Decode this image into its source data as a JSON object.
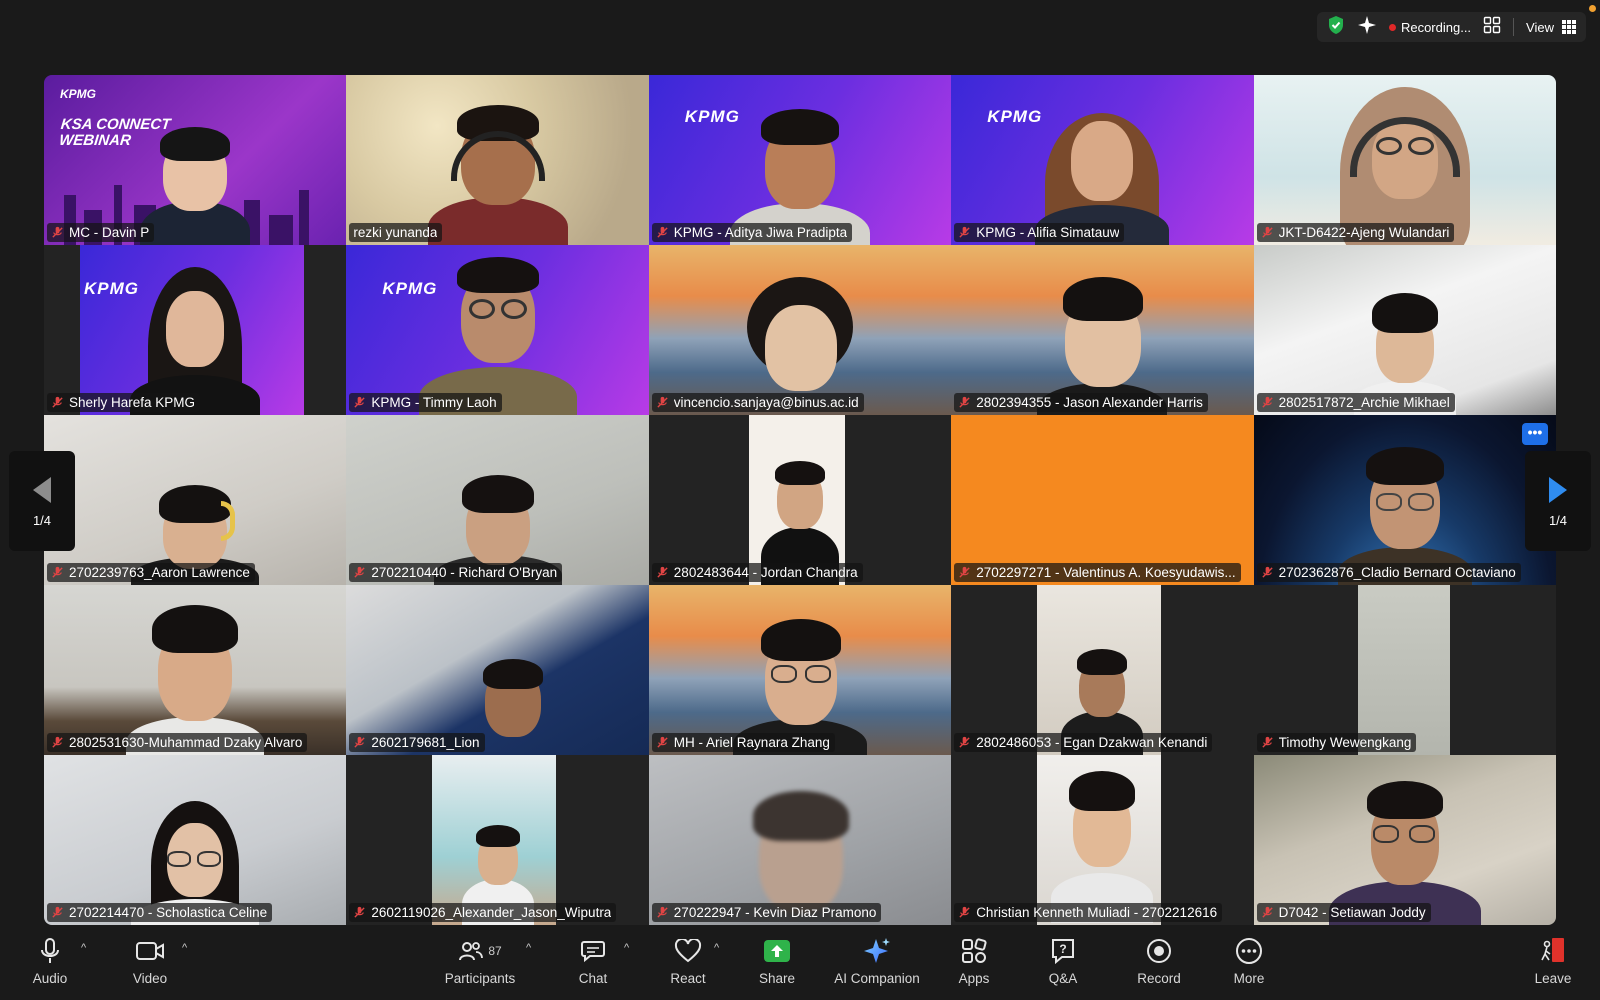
{
  "topbar": {
    "recording": "Recording...",
    "view": "View"
  },
  "pager": {
    "left_label": "1/4",
    "right_label": "1/4"
  },
  "tiles": [
    {
      "name": "MC - Davin P"
    },
    {
      "name": "rezki yunanda"
    },
    {
      "name": "KPMG - Aditya Jiwa Pradipta"
    },
    {
      "name": "KPMG - Alifia Simatauw"
    },
    {
      "name": "JKT-D6422-Ajeng Wulandari"
    },
    {
      "name": "Sherly Harefa KPMG"
    },
    {
      "name": "KPMG - Timmy Laoh"
    },
    {
      "name": "vincencio.sanjaya@binus.ac.id"
    },
    {
      "name": "2802394355 - Jason Alexander Harris"
    },
    {
      "name": "2802517872_Archie Mikhael"
    },
    {
      "name": "2702239763_Aaron Lawrence"
    },
    {
      "name": "2702210440 - Richard O'Bryan"
    },
    {
      "name": "2802483644 - Jordan Chandra"
    },
    {
      "name": "2702297271 - Valentinus A. Koesyudawis..."
    },
    {
      "name": "2702362876_Cladio Bernard Octaviano"
    },
    {
      "name": "2802531630-Muhammad Dzaky Alvaro"
    },
    {
      "name": "2602179681_Lion"
    },
    {
      "name": "MH - Ariel Raynara Zhang"
    },
    {
      "name": "2802486053 - Egan Dzakwan Kenandi"
    },
    {
      "name": "Timothy Wewengkang"
    },
    {
      "name": "2702214470 - Scholastica Celine"
    },
    {
      "name": "2602119026_Alexander_Jason_Wiputra"
    },
    {
      "name": "270222947 - Kevin Diaz Pramono"
    },
    {
      "name": "Christian Kenneth Muliadi - 2702212616"
    },
    {
      "name": "D7042 - Setiawan Joddy"
    }
  ],
  "banner": {
    "brand": "KPMG",
    "title_line1": "KSA CONNECT",
    "title_line2": "WEBINAR"
  },
  "toolbar": {
    "audio": "Audio",
    "video": "Video",
    "participants": "Participants",
    "participants_count": "87",
    "chat": "Chat",
    "react": "React",
    "share": "Share",
    "ai_companion": "AI Companion",
    "apps": "Apps",
    "qa": "Q&A",
    "record": "Record",
    "more": "More",
    "leave": "Leave"
  },
  "colors": {
    "active_speaker": "#3ec64e",
    "share_green": "#2fb34a",
    "more_blue": "#1e6fe8",
    "leave_red": "#e0322b",
    "orange_tile": "#f5891f",
    "kpmg_purple": "#7a2bd6"
  }
}
